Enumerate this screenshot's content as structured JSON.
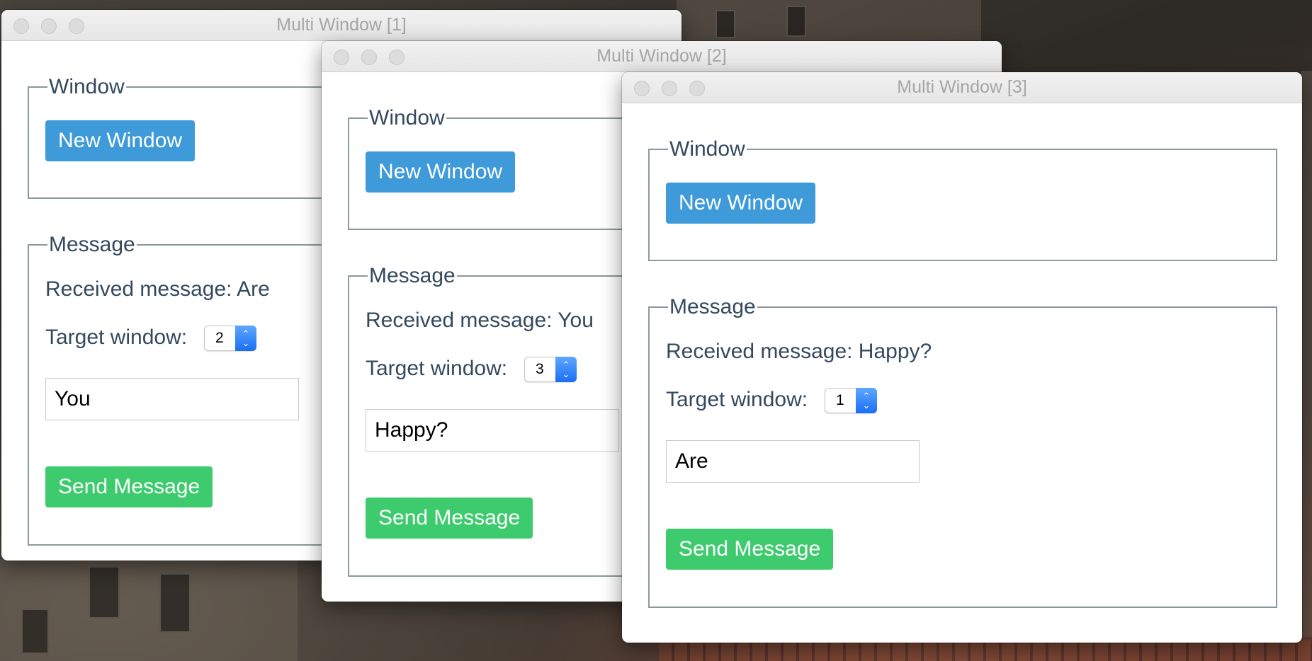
{
  "windows": [
    {
      "title": "Multi Window [1]",
      "window_section": {
        "legend": "Window",
        "new_window_label": "New Window"
      },
      "message_section": {
        "legend": "Message",
        "received_text": "Received message: Are",
        "target_label": "Target window:",
        "target_value": "2",
        "input_value": "You",
        "send_label": "Send Message"
      }
    },
    {
      "title": "Multi Window [2]",
      "window_section": {
        "legend": "Window",
        "new_window_label": "New Window"
      },
      "message_section": {
        "legend": "Message",
        "received_text": "Received message: You",
        "target_label": "Target window:",
        "target_value": "3",
        "input_value": "Happy?",
        "send_label": "Send Message"
      }
    },
    {
      "title": "Multi Window [3]",
      "window_section": {
        "legend": "Window",
        "new_window_label": "New Window"
      },
      "message_section": {
        "legend": "Message",
        "received_text": "Received message: Happy?",
        "target_label": "Target window:",
        "target_value": "1",
        "input_value": "Are",
        "send_label": "Send Message"
      }
    }
  ],
  "colors": {
    "primary_button": "#3e9ad8",
    "success_button": "#3dcb6e",
    "text": "#34495e",
    "fieldset_border": "#8a9a9a"
  }
}
